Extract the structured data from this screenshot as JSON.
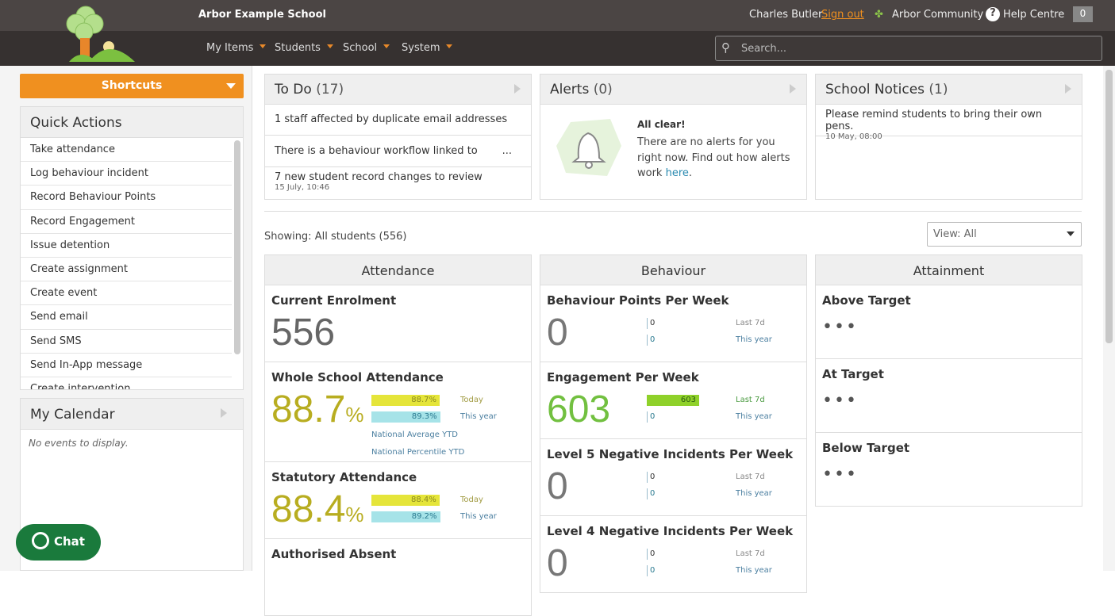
{
  "header": {
    "school": "Arbor Example School",
    "user": "Charles Butler",
    "sign_out": "Sign out",
    "community": "Arbor Community",
    "help": "Help Centre",
    "notifications": "0",
    "search_placeholder": "Search..."
  },
  "nav": [
    "My Items",
    "Students",
    "School",
    "System"
  ],
  "sidebar": {
    "shortcuts": "Shortcuts",
    "quick_actions_title": "Quick Actions",
    "quick_actions": [
      "Take attendance",
      "Log behaviour incident",
      "Record Behaviour Points",
      "Record Engagement",
      "Issue detention",
      "Create assignment",
      "Create event",
      "Send email",
      "Send SMS",
      "Send In-App message",
      "Create intervention"
    ],
    "calendar_title": "My Calendar",
    "calendar_empty": "No events to display."
  },
  "todo": {
    "title": "To Do",
    "count": "(17)",
    "items": [
      {
        "text": "1 staff affected by duplicate email addresses"
      },
      {
        "text": "There is a behaviour workflow linked to",
        "more": "..."
      },
      {
        "text": "7 new student record changes to review",
        "date": "15 July, 10:46"
      }
    ]
  },
  "alerts": {
    "title": "Alerts",
    "count": "(0)",
    "heading": "All clear!",
    "text": "There are no alerts for you right now. Find out how alerts work",
    "link": "here",
    "end": "."
  },
  "notices": {
    "title": "School Notices",
    "count": "(1)",
    "text": "Please remind students to bring their own pens.",
    "date": "10 May, 08:00"
  },
  "showing": "Showing: All students (556)",
  "view": "View: All",
  "attendance": {
    "title": "Attendance",
    "enrolment_label": "Current Enrolment",
    "enrolment": "556",
    "whole": {
      "label": "Whole School Attendance",
      "value": "88.7",
      "pct": "%",
      "today": "88.7%",
      "today_label": "Today",
      "year": "89.3%",
      "year_label": "This year",
      "nat_avg": "National Average YTD",
      "nat_pct": "National Percentile YTD",
      "today_val": 88.7,
      "year_val": 89.3
    },
    "statutory": {
      "label": "Statutory Attendance",
      "value": "88.4",
      "pct": "%",
      "today": "88.4%",
      "today_label": "Today",
      "year": "89.2%",
      "year_label": "This year",
      "today_val": 88.4,
      "year_val": 89.2
    },
    "auth_label": "Authorised Absent"
  },
  "behaviour": {
    "title": "Behaviour",
    "items": [
      {
        "label": "Behaviour Points Per Week",
        "value": "0",
        "last": "0",
        "year": "0",
        "last_label": "Last 7d",
        "year_label": "This year"
      },
      {
        "label": "Engagement Per Week",
        "value": "603",
        "last": "603",
        "year": "0",
        "last_label": "Last 7d",
        "year_label": "This year"
      },
      {
        "label": "Level 5 Negative Incidents Per Week",
        "value": "0",
        "last": "0",
        "year": "0",
        "last_label": "Last 7d",
        "year_label": "This year"
      },
      {
        "label": "Level 4 Negative Incidents Per Week",
        "value": "0",
        "last": "0",
        "year": "0",
        "last_label": "Last 7d",
        "year_label": "This year"
      }
    ]
  },
  "attainment": {
    "title": "Attainment",
    "items": [
      "Above Target",
      "At Target",
      "Below Target"
    ],
    "loading": "•••"
  },
  "chat": "Chat",
  "colors": {
    "accent": "#f0901f",
    "yellow": "#b8ad20",
    "green": "#72c040",
    "cyan": "#a6e3e8"
  }
}
